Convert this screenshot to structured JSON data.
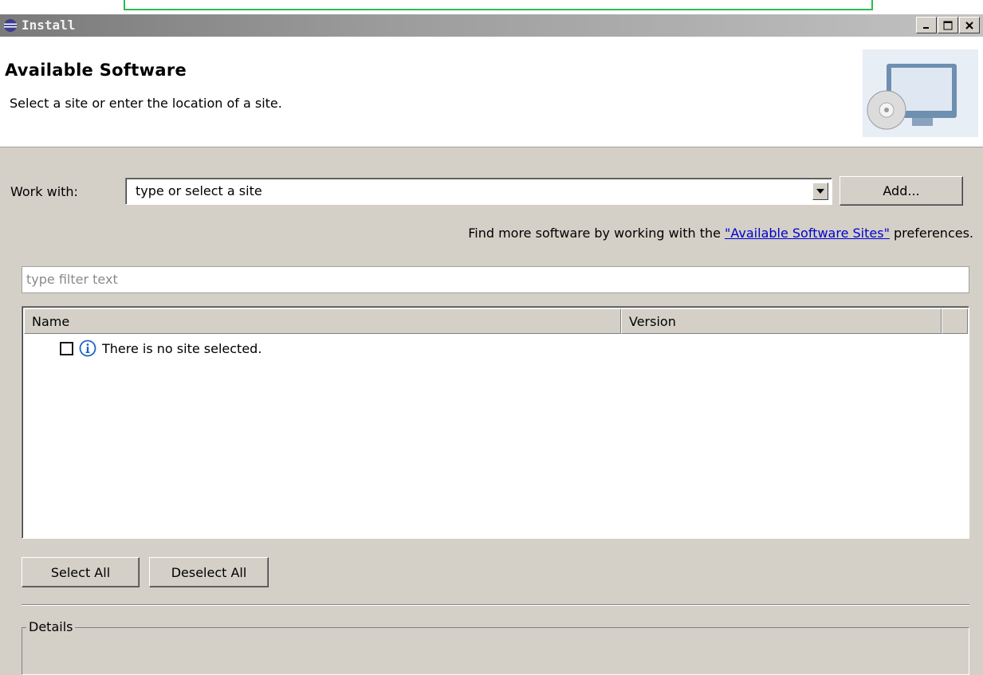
{
  "window": {
    "title": "Install"
  },
  "header": {
    "title": "Available Software",
    "description": "Select a site or enter the location of a site."
  },
  "work_with": {
    "label": "Work with:",
    "value": "type or select a site",
    "add_button": "Add..."
  },
  "find_more": {
    "prefix": "Find more software by working with the ",
    "link": "\"Available Software Sites\"",
    "suffix": " preferences."
  },
  "filter": {
    "placeholder": "type filter text"
  },
  "table": {
    "columns": [
      "Name",
      "Version"
    ],
    "rows": [
      {
        "name": "There is no site selected.",
        "version": "",
        "checked": false
      }
    ]
  },
  "buttons": {
    "select_all": "Select All",
    "deselect_all": "Deselect All"
  },
  "details": {
    "label": "Details"
  },
  "icons": {
    "title": "eclipse-icon",
    "header": "computer-cd-icon",
    "row": "info-icon",
    "dropdown": "chevron-down-icon"
  },
  "colors": {
    "titlebar_start": "#7a7a7a",
    "titlebar_end": "#c2c2c2",
    "dialog_bg": "#d4d0c8",
    "link": "#0000cc",
    "info_icon": "#1e64c8",
    "highlight_box": "#2cbc55"
  }
}
